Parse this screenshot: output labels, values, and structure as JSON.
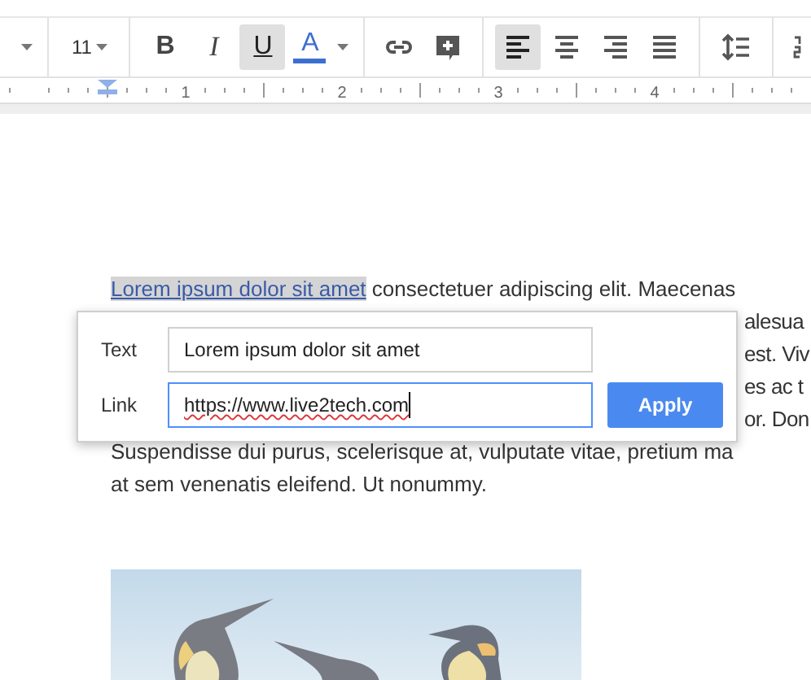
{
  "toolbar": {
    "font_size": "11",
    "buttons": [
      {
        "kind": "bold",
        "label": "B",
        "selected": false
      },
      {
        "kind": "italic",
        "label": "I",
        "selected": false
      },
      {
        "kind": "underline",
        "label": "U",
        "selected": true
      },
      {
        "kind": "text-color",
        "label": "A",
        "selected": false,
        "color": "#3d6fd0"
      },
      {
        "kind": "link",
        "selected": false
      },
      {
        "kind": "comment",
        "selected": false
      },
      {
        "kind": "align-left",
        "selected": true
      },
      {
        "kind": "align-center",
        "selected": false
      },
      {
        "kind": "align-right",
        "selected": false
      },
      {
        "kind": "justify",
        "selected": false
      },
      {
        "kind": "line-spacing",
        "selected": false
      },
      {
        "kind": "numbered-list",
        "selected": false
      }
    ]
  },
  "ruler": {
    "labels": [
      "1",
      "2",
      "3",
      "4"
    ]
  },
  "document": {
    "link_text": "Lorem ipsum dolor sit amet",
    "first_line_rest": " consectetuer adipiscing elit. Maecenas",
    "covered_lines": [
      "alesua",
      "est. Viv",
      "es ac t",
      "or. Don"
    ],
    "lines": [
      "Suspendisse dui purus, scelerisque at, vulputate vitae, pretium ma",
      "at sem venenatis eleifend. Ut nonummy."
    ]
  },
  "link_popup": {
    "text_label": "Text",
    "text_value": "Lorem ipsum dolor sit amet",
    "link_label": "Link",
    "link_value": "https://www.live2tech.com",
    "apply": "Apply"
  }
}
